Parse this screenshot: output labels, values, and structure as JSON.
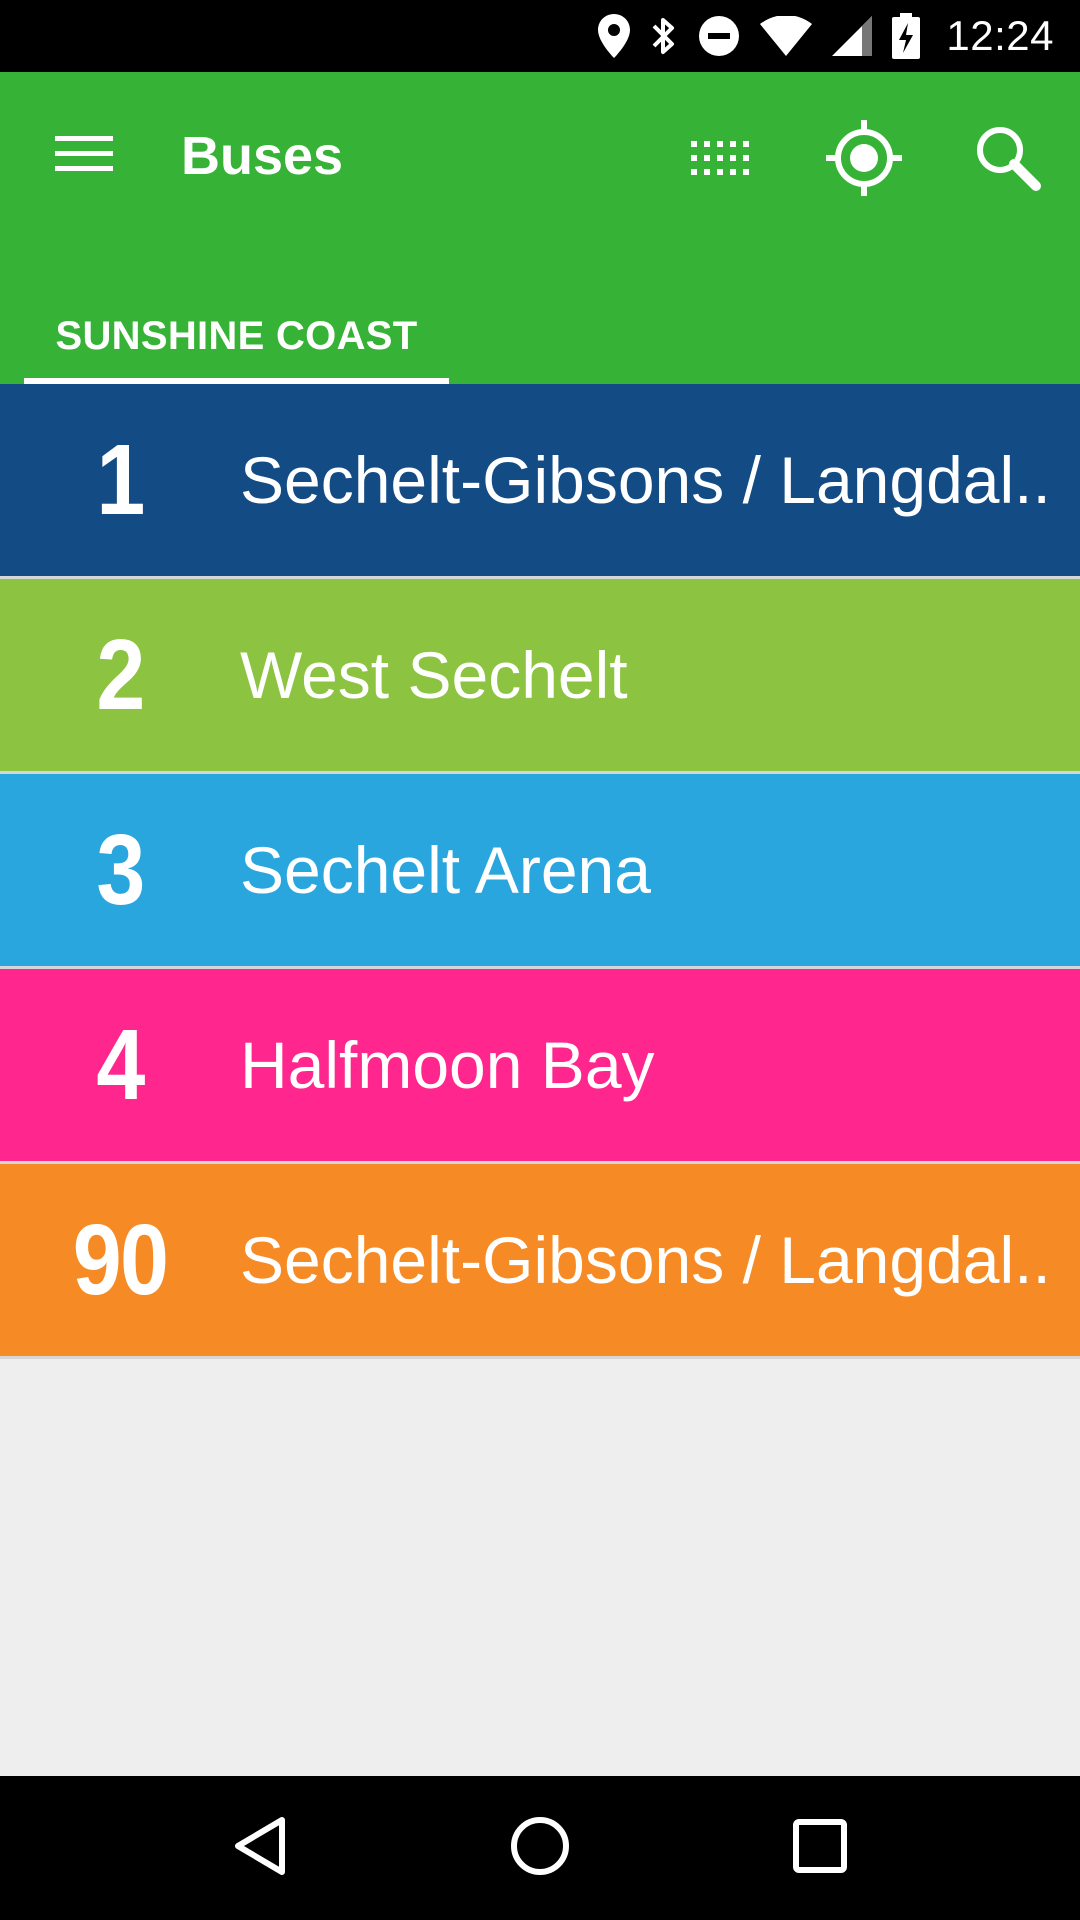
{
  "status_bar": {
    "time": "12:24",
    "icons": [
      "location-icon",
      "bluetooth-icon",
      "do-not-disturb-icon",
      "wifi-icon",
      "cell-signal-icon",
      "battery-charging-icon"
    ]
  },
  "app_bar": {
    "title": "Buses",
    "color": "#36b336",
    "actions": [
      "menu-icon",
      "grid-icon",
      "my-location-icon",
      "search-icon"
    ]
  },
  "tabs": [
    {
      "label": "SUNSHINE COAST",
      "selected": true
    }
  ],
  "routes": [
    {
      "number": "1",
      "name": "Sechelt-Gibsons / Langdal..",
      "color": "#134b85"
    },
    {
      "number": "2",
      "name": "West Sechelt",
      "color": "#8cc341"
    },
    {
      "number": "3",
      "name": "Sechelt Arena",
      "color": "#2aa6df"
    },
    {
      "number": "4",
      "name": "Halfmoon Bay",
      "color": "#ff278d"
    },
    {
      "number": "90",
      "name": "Sechelt-Gibsons / Langdal..",
      "color": "#f68b26"
    }
  ],
  "nav_bar": {
    "buttons": [
      "back-icon",
      "home-icon",
      "recents-icon"
    ]
  }
}
